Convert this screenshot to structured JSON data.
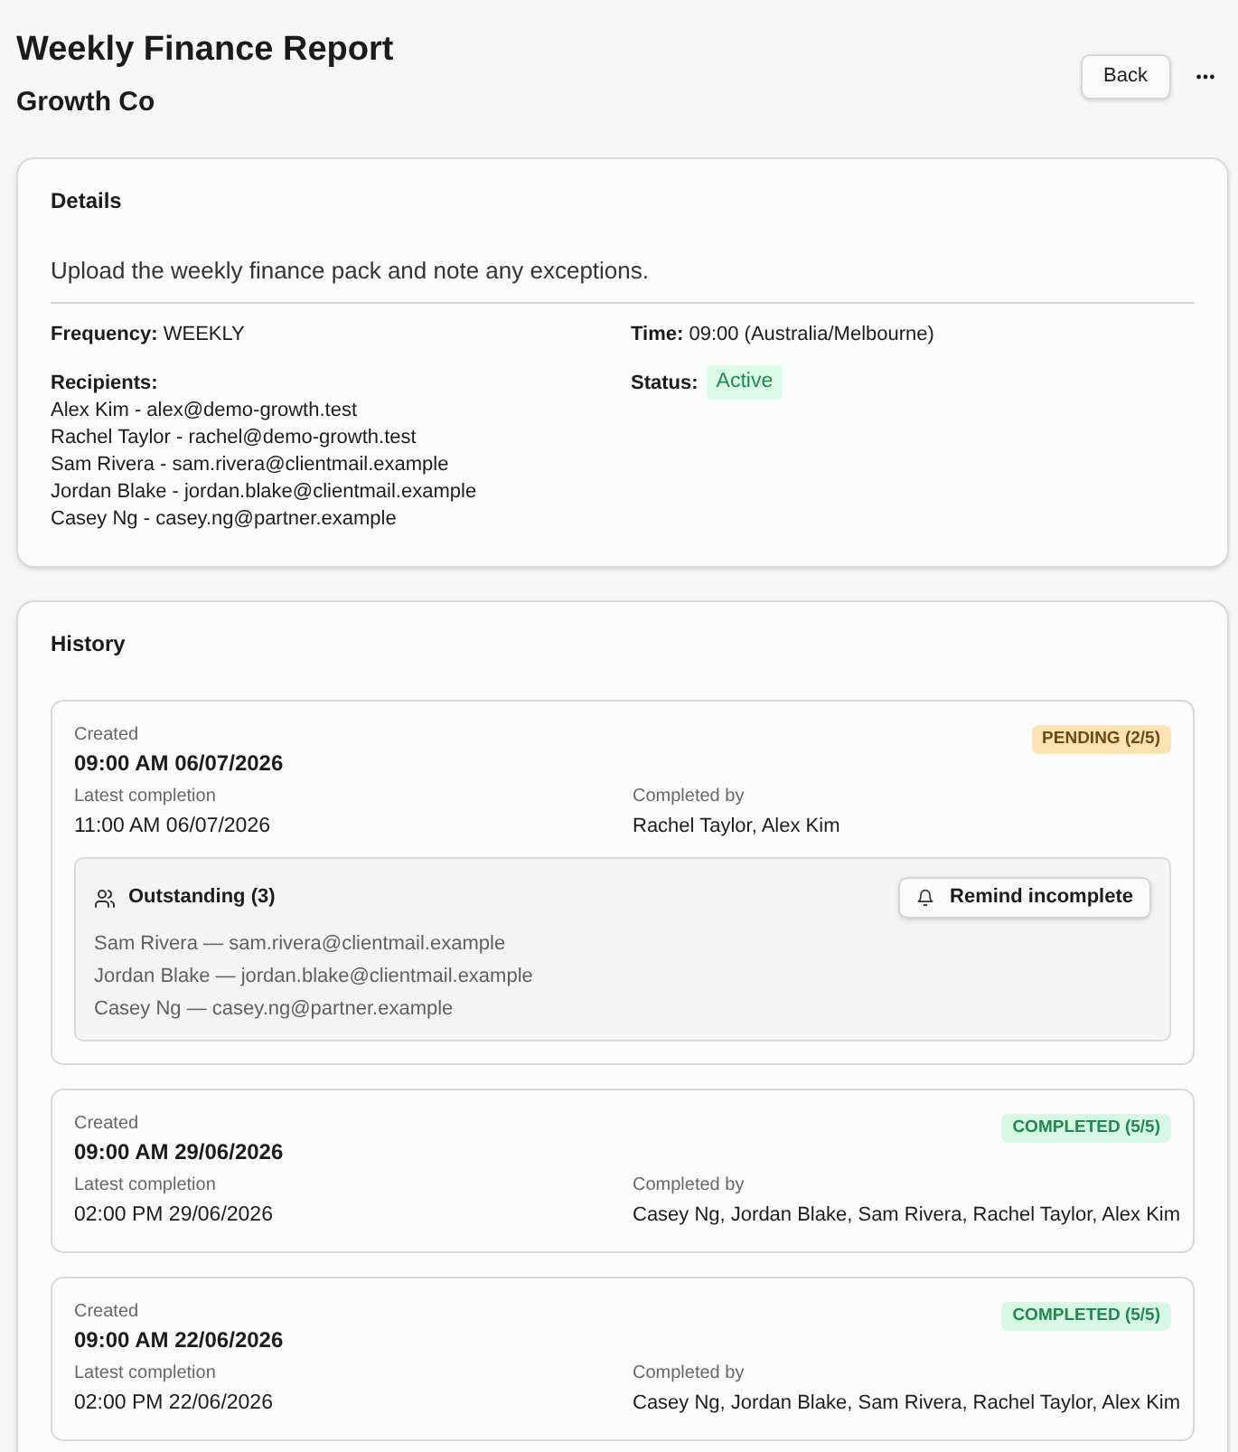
{
  "header": {
    "title": "Weekly Finance Report",
    "subtitle": "Growth Co",
    "back_button": "Back"
  },
  "details": {
    "heading": "Details",
    "description": "Upload the weekly finance pack and note any exceptions.",
    "fields": [
      {
        "label": "Frequency:",
        "value": "WEEKLY"
      },
      {
        "label": "Time:",
        "value": "09:00 (Australia/Melbourne)"
      }
    ],
    "recipients": {
      "label": "Recipients:",
      "items": [
        "Alex Kim - alex@demo-growth.test",
        "Rachel Taylor - rachel@demo-growth.test",
        "Sam Rivera - sam.rivera@clientmail.example",
        "Jordan Blake - jordan.blake@clientmail.example",
        "Casey Ng - casey.ng@partner.example"
      ]
    },
    "status": {
      "label": "Status:",
      "value": "Active",
      "kind": "active"
    }
  },
  "history": {
    "heading": "History",
    "runs": [
      {
        "created_label": "Created",
        "created": "09:00 AM 06/07/2026",
        "status": {
          "text": "PENDING (2/5)",
          "kind": "pending"
        },
        "latest_label": "Latest completion",
        "latest": "11:00 AM 06/07/2026",
        "completed_by_label": "Completed by",
        "completed_by": "Rachel Taylor, Alex Kim",
        "outstanding": {
          "heading": "Outstanding (3)",
          "remind_button": "Remind incomplete",
          "items": [
            "Sam Rivera — sam.rivera@clientmail.example",
            "Jordan Blake — jordan.blake@clientmail.example",
            "Casey Ng — casey.ng@partner.example"
          ]
        }
      },
      {
        "created_label": "Created",
        "created": "09:00 AM 29/06/2026",
        "status": {
          "text": "COMPLETED (5/5)",
          "kind": "completed"
        },
        "latest_label": "Latest completion",
        "latest": "02:00 PM 29/06/2026",
        "completed_by_label": "Completed by",
        "completed_by": "Casey Ng, Jordan Blake, Sam Rivera, Rachel Taylor, Alex Kim"
      },
      {
        "created_label": "Created",
        "created": "09:00 AM 22/06/2026",
        "status": {
          "text": "COMPLETED (5/5)",
          "kind": "completed"
        },
        "latest_label": "Latest completion",
        "latest": "02:00 PM 22/06/2026",
        "completed_by_label": "Completed by",
        "completed_by": "Casey Ng, Jordan Blake, Sam Rivera, Rachel Taylor, Alex Kim"
      }
    ]
  }
}
